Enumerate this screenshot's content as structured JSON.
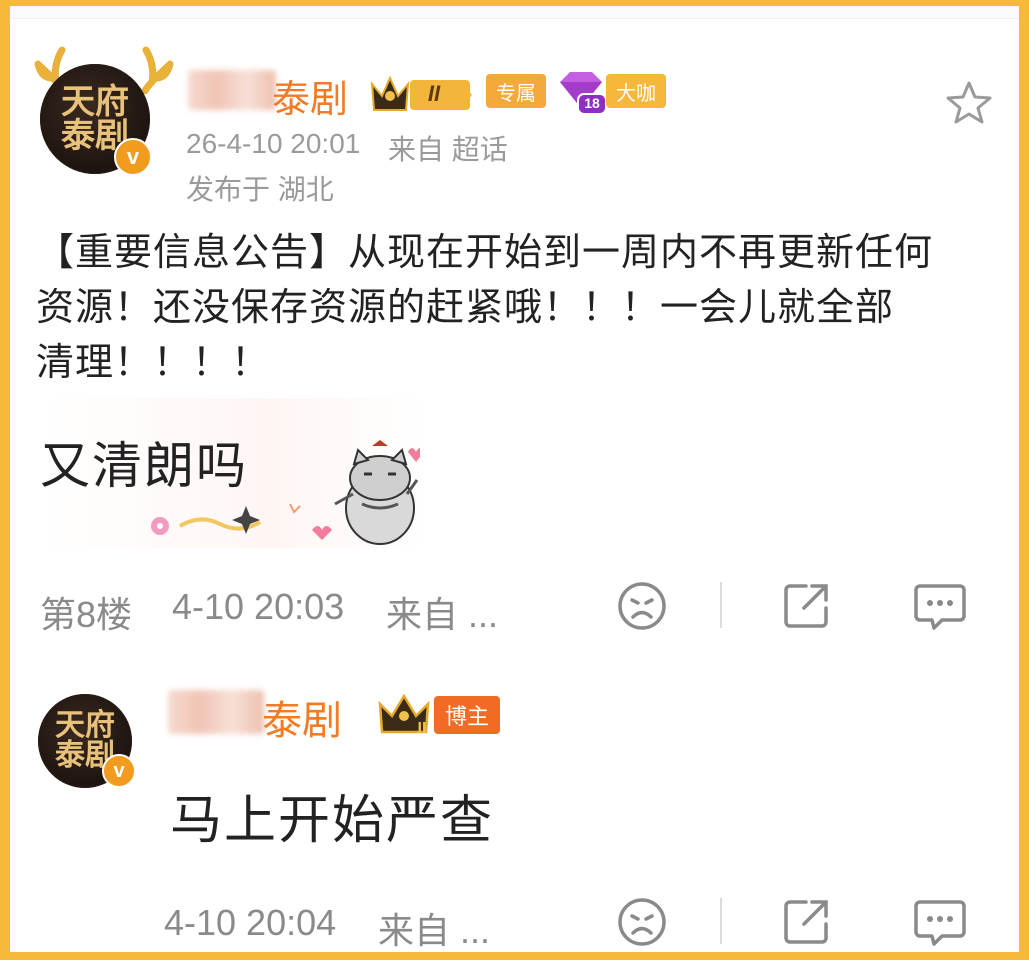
{
  "post": {
    "avatar_lines": [
      "天府",
      "泰剧"
    ],
    "verified_mark": "v",
    "name_suffix": "泰剧",
    "level_badge": "II",
    "tag_exclusive": "专属",
    "gem_level": "18",
    "tag_bigshot": "大咖",
    "time": "26-4-10 20:01",
    "source": "来自 超话",
    "location": "发布于 湖北",
    "text_lines": [
      "【重要信息公告】从现在开始到一周内不再更新任何",
      "资源！还没保存资源的赶紧哦！！！一会儿就全部",
      "清理！！！！"
    ]
  },
  "comment": {
    "text": "又清朗吗",
    "floor": "第8楼",
    "time": "4-10 20:03",
    "source": "来自 ..."
  },
  "reply": {
    "avatar_lines": [
      "天府",
      "泰剧"
    ],
    "verified_mark": "v",
    "name_suffix": "泰剧",
    "level_badge": "II",
    "tag_host": "博主",
    "text": "马上开始严查",
    "time": "4-10 20:04",
    "source": "来自 ..."
  },
  "colors": {
    "accent": "#f47b26",
    "frame": "#f7b93a",
    "gray": "#9a9a9a"
  }
}
